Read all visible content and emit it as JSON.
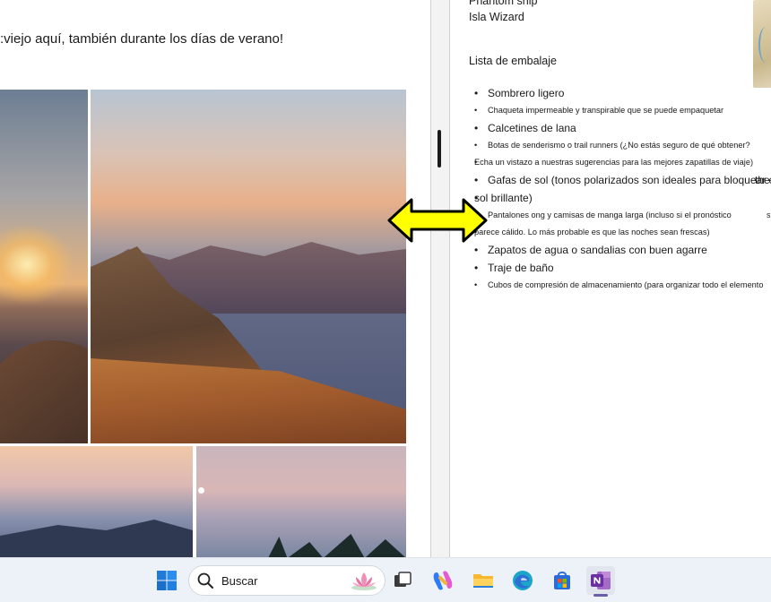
{
  "left_document": {
    "text_line": ":viejo aquí, también durante los días de verano!"
  },
  "right_notes": {
    "top_lines": [
      "Phantom ship",
      "Isla Wizard"
    ],
    "list_title": "Lista de embalaje",
    "items": [
      {
        "text": "Sombrero ligero",
        "size": "big"
      },
      {
        "text": "Chaqueta impermeable y transpirable que se puede empaquetar",
        "size": "small"
      },
      {
        "text": "Calcetines de lana",
        "size": "big"
      },
      {
        "text": "Botas de senderismo o trail runners (¿No estás seguro de qué obtener?",
        "size": "small"
      },
      {
        "text": "Echa un vistazo a nuestras sugerencias para las mejores zapatillas de viaje)",
        "size": "small"
      },
      {
        "text": "Gafas de sol (tonos polarizados son ideales para bloquear el",
        "size": "big"
      },
      {
        "text": "sol brillante)",
        "size": "big"
      },
      {
        "text": "Pantalones ong y camisas de manga larga (incluso si el pronóstico",
        "size": "small"
      },
      {
        "text": "parece cálido. Lo más probable es que las noches sean frescas)",
        "size": "small"
      },
      {
        "text": "Zapatos de agua o sandalias con buen agarre",
        "size": "big"
      },
      {
        "text": "Traje de baño",
        "size": "big"
      },
      {
        "text": "Cubos de compresión de almacenamiento (para organizar todo el elemento",
        "size": "small"
      }
    ],
    "overflow_fragments": [
      "the",
      "s"
    ]
  },
  "taskbar": {
    "search_placeholder": "Buscar",
    "apps": [
      "windows-start",
      "search",
      "task-view",
      "copilot",
      "file-explorer",
      "edge",
      "microsoft-store",
      "onenote"
    ],
    "active_app": "onenote",
    "accent_color": "#6b5ea8"
  }
}
